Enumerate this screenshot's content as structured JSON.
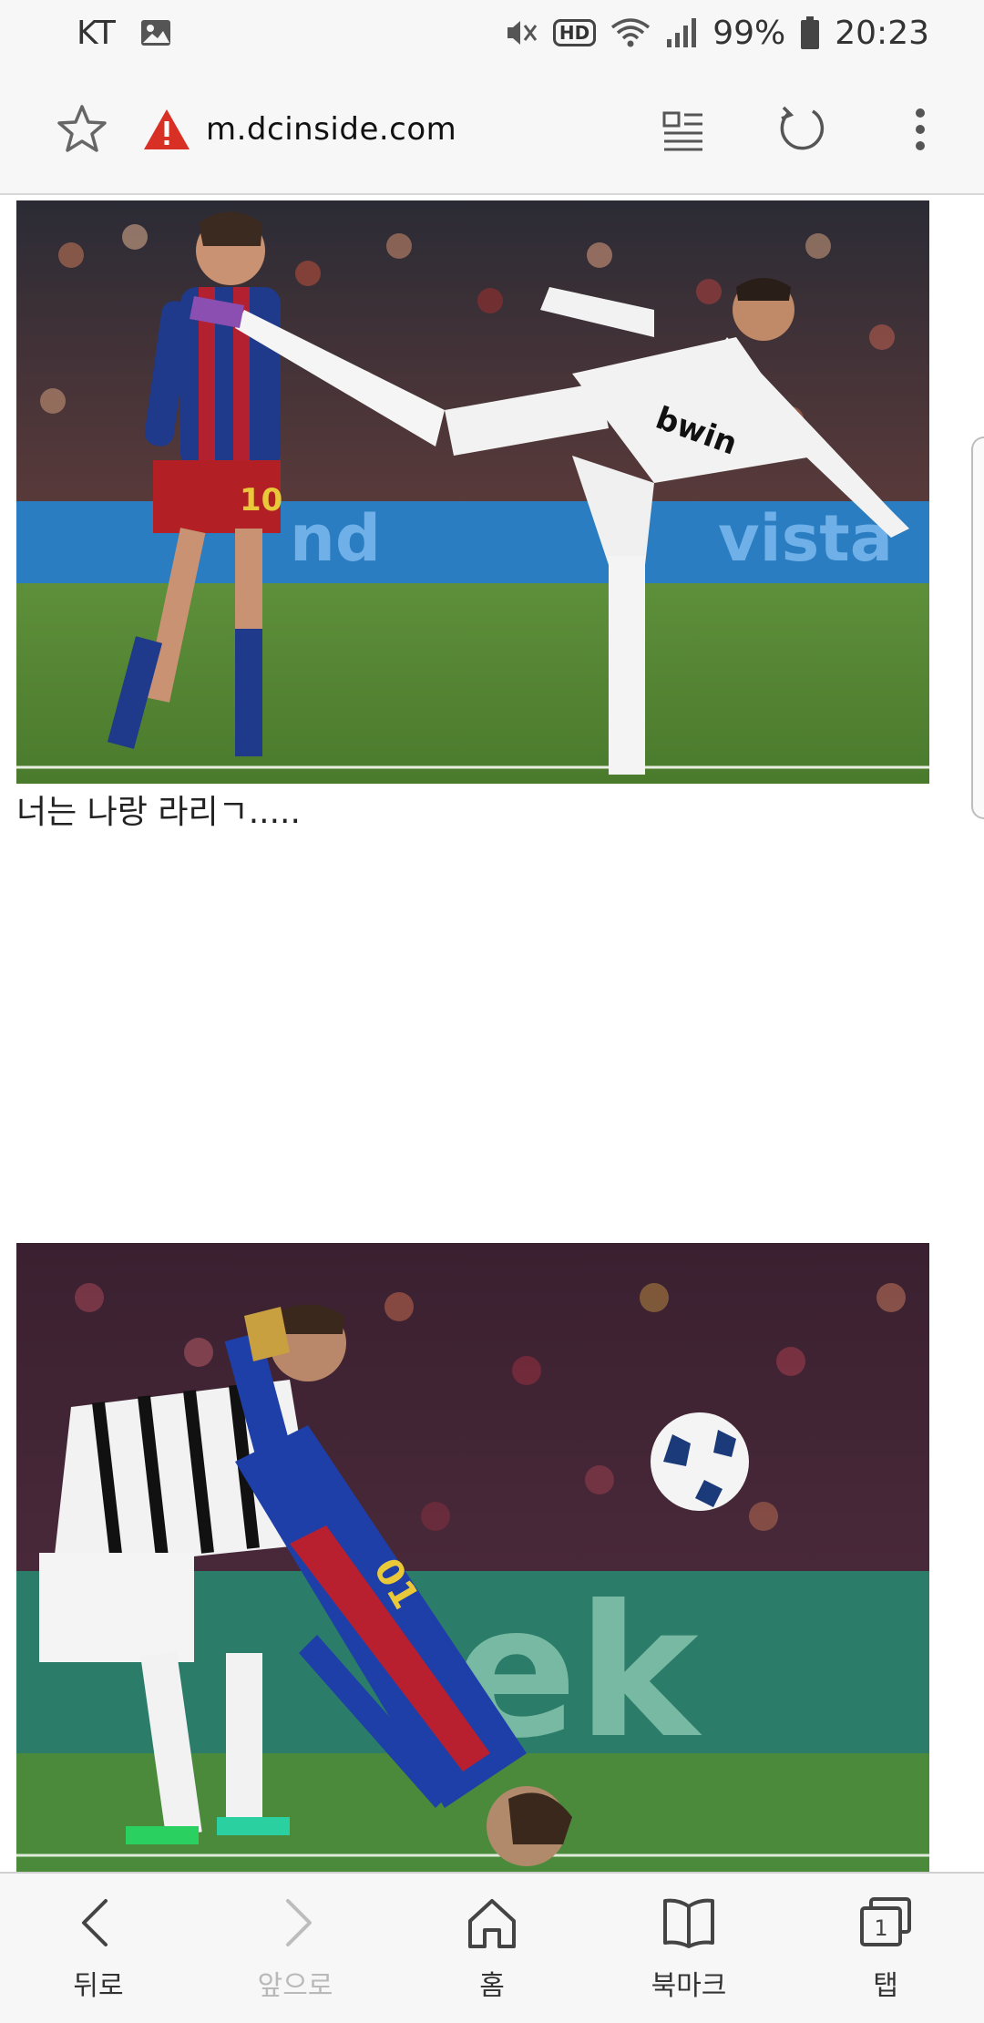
{
  "status_bar": {
    "carrier": "KT",
    "hd": "HD",
    "battery_percent": "99%",
    "time": "20:23",
    "icons": [
      "image-icon",
      "mute-icon",
      "wifi-icon",
      "signal-icon",
      "battery-icon"
    ]
  },
  "url_bar": {
    "url": "m.dcinside.com",
    "icons": [
      "star-icon",
      "warning-icon",
      "reader-icon",
      "reload-icon",
      "more-icon"
    ]
  },
  "content": {
    "caption1": "너는 나랑 라리ㄱ....."
  },
  "bottom_nav": {
    "items": [
      {
        "label": "뒤로",
        "icon": "back-icon",
        "enabled": true
      },
      {
        "label": "앞으로",
        "icon": "forward-icon",
        "enabled": false
      },
      {
        "label": "홈",
        "icon": "home-icon",
        "enabled": true
      },
      {
        "label": "북마크",
        "icon": "bookmark-icon",
        "enabled": true
      },
      {
        "label": "탭",
        "icon": "tabs-icon",
        "enabled": true,
        "tab_count": "1"
      }
    ]
  }
}
